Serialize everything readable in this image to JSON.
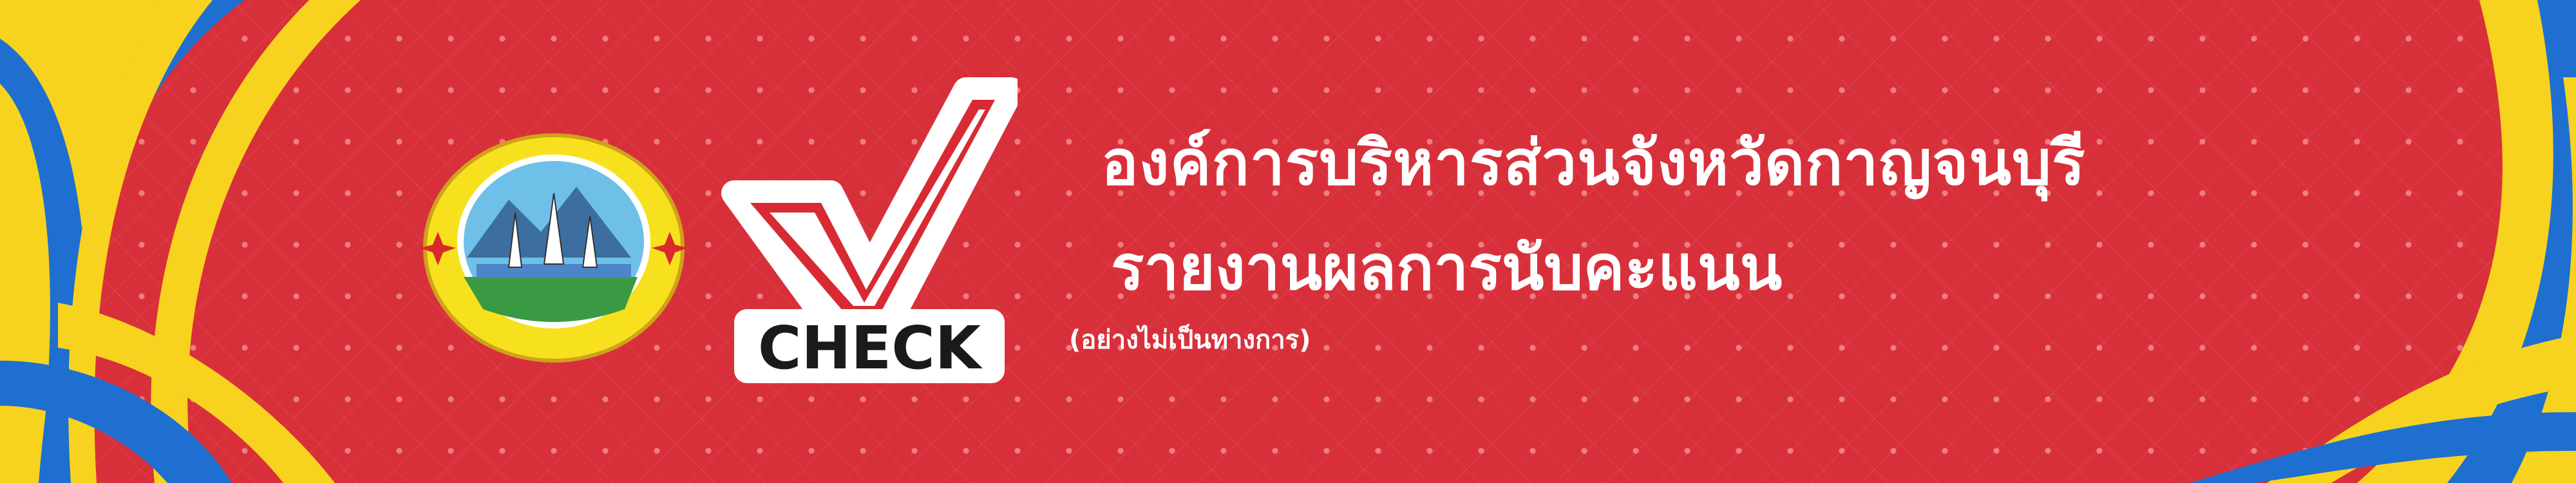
{
  "header": {
    "title": "องค์การบริหารส่วนจังหวัดกาญจนบุรี",
    "subtitle": "รายงานผลการนับคะแนน",
    "note": "(อย่างไม่เป็นทางการ)"
  },
  "logo": {
    "ring_text": "องค์การบริหารส่วนจังหวัดกาญจนบุรี",
    "icon": "provincial-seal-icon"
  },
  "check_badge": {
    "label": "CHECK",
    "icon": "checkmark-icon"
  },
  "colors": {
    "background": "#d8303a",
    "accent_yellow": "#f7d21e",
    "accent_blue": "#1e6fd0",
    "text": "#ffffff"
  }
}
